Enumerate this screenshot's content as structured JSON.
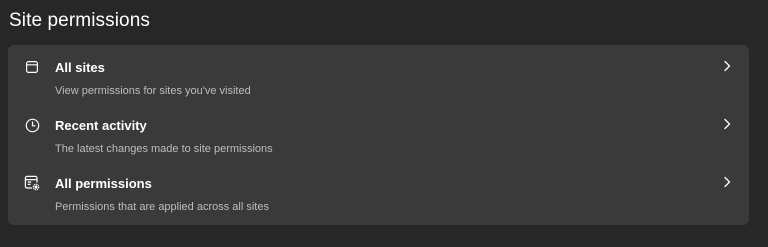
{
  "page": {
    "title": "Site permissions"
  },
  "items": [
    {
      "label": "All sites",
      "description": "View permissions for sites you've visited",
      "icon": "browser-page-icon"
    },
    {
      "label": "Recent activity",
      "description": "The latest changes made to site permissions",
      "icon": "clock-icon"
    },
    {
      "label": "All permissions",
      "description": "Permissions that are applied across all sites",
      "icon": "window-settings-icon"
    }
  ],
  "colors": {
    "background": "#272727",
    "card": "#3a3a3a",
    "text": "#ffffff",
    "secondary_text": "#bdbdbd"
  }
}
